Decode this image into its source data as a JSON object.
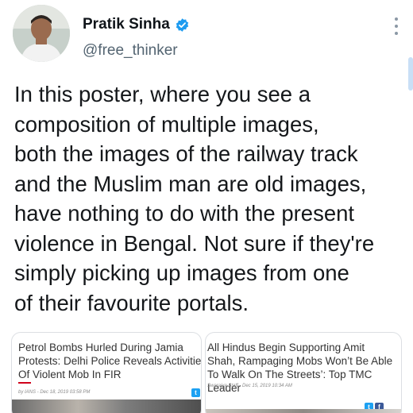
{
  "tweet": {
    "author_name": "Pratik Sinha",
    "handle": "@free_thinker",
    "text": "In this poster, where you see a\ncomposition of multiple images,\nboth the images of the railway track\nand the Muslim man are old images,\nhave nothing to do with the present\nviolence in Bengal. Not sure if they're\nsimply picking up images from one\nof their favourite portals."
  },
  "cards": [
    {
      "headline": "Petrol Bombs Hurled During Jamia\nProtests: Delhi Police Reveals Activities\nOf Violent Mob In FIR",
      "meta": "by IANS - Dec 18, 2019 03:58 PM"
    },
    {
      "headline": "All Hindus Begin Supporting Amit\nShah, Rampaging Mobs Won’t Be Able\nTo Walk On The Streets’: Top TMC\nLeader",
      "meta": "Swarajya Staff - Dec 15, 2019 10:34 AM"
    }
  ],
  "icons": {
    "verified": "verified-badge-icon",
    "more": "more-options-icon",
    "twitter_share": "twitter-share-icon",
    "facebook_share": "facebook-share-icon"
  },
  "colors": {
    "verified_blue": "#1d9bf0",
    "handle_gray": "#536471",
    "accent_red": "#d0021b"
  }
}
